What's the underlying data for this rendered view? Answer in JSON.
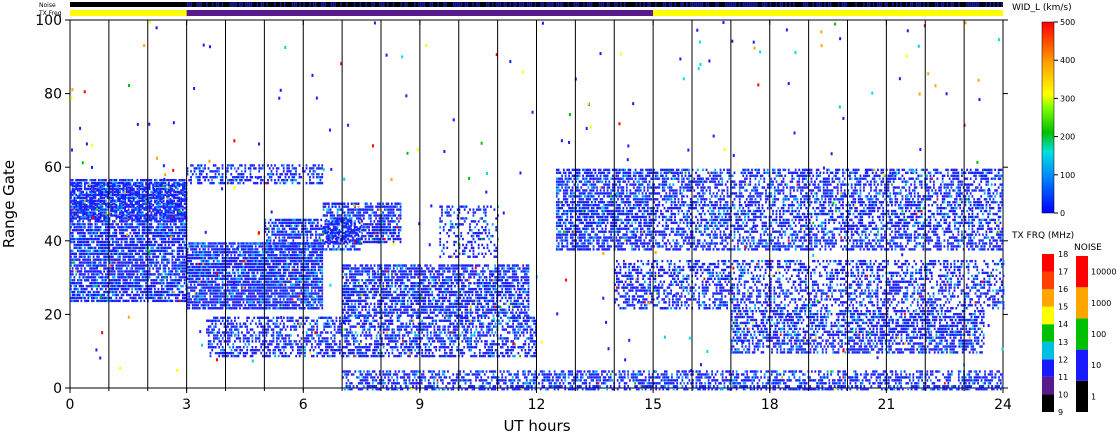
{
  "header": {
    "noise_label": "Noise",
    "txfreq_label": "TX Freq"
  },
  "chart_data": {
    "type": "heatmap",
    "xlabel": "UT hours",
    "ylabel": "Range Gate",
    "xlim": [
      0,
      24
    ],
    "ylim": [
      0,
      100
    ],
    "xticks": [
      "0",
      "3",
      "6",
      "9",
      "12",
      "15",
      "18",
      "21",
      "24"
    ],
    "yticks": [
      "0",
      "20",
      "40",
      "60",
      "80",
      "100"
    ],
    "scan_boundaries_hours": [
      1,
      2,
      3,
      4,
      5,
      6,
      7,
      8,
      9,
      10,
      11,
      12,
      13,
      14,
      15,
      16,
      17,
      18,
      19,
      20,
      21,
      22,
      23
    ],
    "echo_bands": [
      {
        "x0": 0.0,
        "x1": 3.0,
        "y0": 24,
        "y1": 57,
        "density": 0.8
      },
      {
        "x0": 0.0,
        "x1": 3.0,
        "y0": 46,
        "y1": 56,
        "density": 0.5
      },
      {
        "x0": 3.0,
        "x1": 6.5,
        "y0": 22,
        "y1": 40,
        "density": 0.85
      },
      {
        "x0": 3.0,
        "x1": 6.5,
        "y0": 56,
        "y1": 61,
        "density": 0.45
      },
      {
        "x0": 5.0,
        "x1": 7.5,
        "y0": 38,
        "y1": 46,
        "density": 0.6
      },
      {
        "x0": 6.5,
        "x1": 8.5,
        "y0": 40,
        "y1": 51,
        "density": 0.7
      },
      {
        "x0": 3.5,
        "x1": 12.0,
        "y0": 9,
        "y1": 20,
        "density": 0.55
      },
      {
        "x0": 7.0,
        "x1": 11.8,
        "y0": 20,
        "y1": 34,
        "density": 0.7
      },
      {
        "x0": 9.5,
        "x1": 11.0,
        "y0": 36,
        "y1": 50,
        "density": 0.35
      },
      {
        "x0": 12.5,
        "x1": 15.0,
        "y0": 38,
        "y1": 60,
        "density": 0.7
      },
      {
        "x0": 14.0,
        "x1": 24.0,
        "y0": 22,
        "y1": 35,
        "density": 0.45
      },
      {
        "x0": 15.0,
        "x1": 24.0,
        "y0": 38,
        "y1": 60,
        "density": 0.55
      },
      {
        "x0": 17.0,
        "x1": 23.5,
        "y0": 10,
        "y1": 22,
        "density": 0.6
      },
      {
        "x0": 7.0,
        "x1": 24.0,
        "y0": 0,
        "y1": 5,
        "density": 0.55
      }
    ],
    "colorbars": [
      {
        "title": "WID_L (km/s)",
        "ticks": [
          "0",
          "100",
          "200",
          "300",
          "400",
          "500"
        ]
      },
      {
        "title": "TX FRQ (MHz)",
        "ticks": [
          "9",
          "10",
          "11",
          "12",
          "13",
          "14",
          "15",
          "16",
          "17",
          "18"
        ]
      },
      {
        "title": "NOISE",
        "ticks": [
          "1",
          "10",
          "100",
          "1000",
          "10000"
        ]
      }
    ],
    "colors": {
      "noise_bar": "#1a1a9e",
      "freq_low": "#5a1a8c",
      "freq_high": "#ffff00",
      "echo_main": "#1a1aff"
    }
  }
}
